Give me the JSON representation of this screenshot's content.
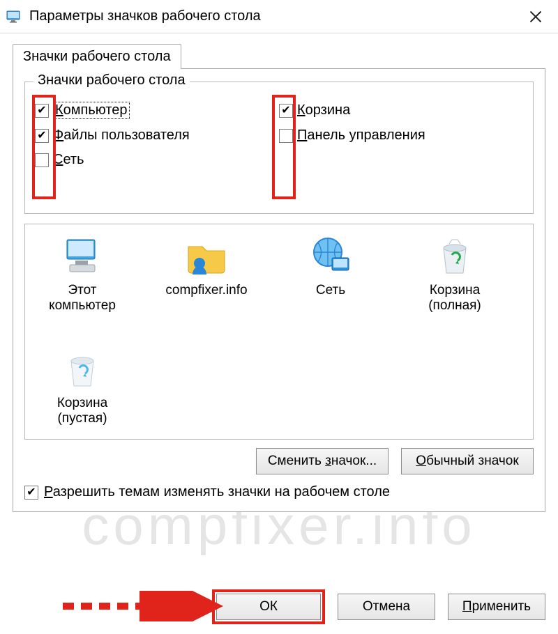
{
  "window": {
    "title": "Параметры значков рабочего стола"
  },
  "tabs": {
    "main": "Значки рабочего стола"
  },
  "group": {
    "legend": "Значки рабочего стола",
    "checks": {
      "computer": {
        "label": "Компьютер",
        "ul": "К",
        "checked": true
      },
      "userfiles": {
        "label": "Файлы пользователя",
        "ul": "Ф",
        "checked": true
      },
      "network": {
        "label": "Сеть",
        "ul": "С",
        "checked": false
      },
      "recyclebin": {
        "label": "Корзина",
        "ul": "К",
        "checked": true
      },
      "controlpanel": {
        "label": "Панель управления",
        "ul": "П",
        "checked": false
      }
    }
  },
  "icons": {
    "this_computer": "Этот компьютер",
    "user_folder": "compfixer.info",
    "network": "Сеть",
    "recycle_full": "Корзина (полная)",
    "recycle_empty": "Корзина (пустая)"
  },
  "buttons": {
    "change_icon": "Сменить значок...",
    "default_icon": "Обычный значок",
    "ok": "ОК",
    "cancel": "Отмена",
    "apply": "Применить"
  },
  "allow_themes": {
    "label_pre_ul": "",
    "ul": "Р",
    "label_post": "азрешить темам изменять значки на рабочем столе",
    "checked": true
  },
  "watermark": "compfixer.info",
  "annotations": {
    "highlight_color": "#e0241c"
  }
}
